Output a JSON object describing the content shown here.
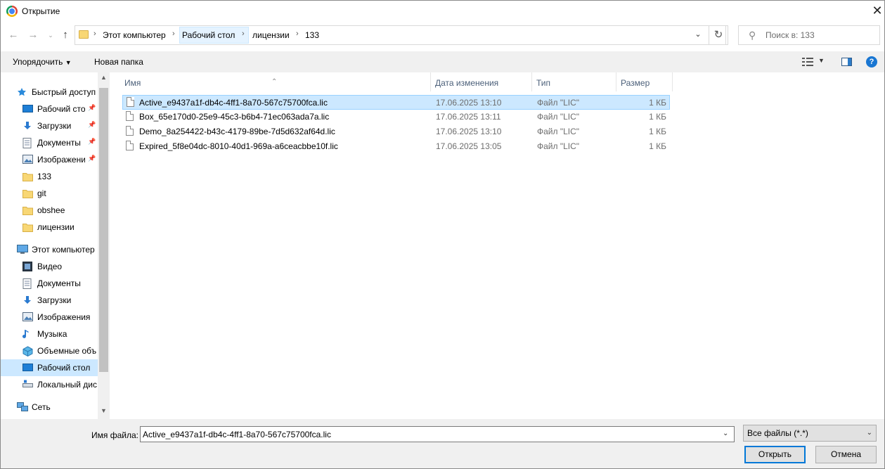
{
  "window": {
    "title": "Открытие"
  },
  "address": {
    "crumbs": [
      "Этот компьютер",
      "Рабочий стол",
      "лицензии",
      "133"
    ],
    "search_placeholder": "Поиск в: 133"
  },
  "toolbar": {
    "organize": "Упорядочить",
    "new_folder": "Новая папка"
  },
  "nav": {
    "items": [
      {
        "label": "Быстрый доступ",
        "icon": "star-icon"
      },
      {
        "label": "Рабочий сто.",
        "icon": "desktop-icon"
      },
      {
        "label": "Загрузки",
        "icon": "download-icon"
      },
      {
        "label": "Документы",
        "icon": "document-icon"
      },
      {
        "label": "Изображени",
        "icon": "pictures-icon"
      },
      {
        "label": "133",
        "icon": "folder-icon"
      },
      {
        "label": "git",
        "icon": "folder-icon"
      },
      {
        "label": "obshee",
        "icon": "folder-icon"
      },
      {
        "label": "лицензии",
        "icon": "folder-icon"
      },
      {
        "label": "Этот компьютер",
        "icon": "computer-icon"
      },
      {
        "label": "Видео",
        "icon": "video-icon"
      },
      {
        "label": "Документы",
        "icon": "document-icon"
      },
      {
        "label": "Загрузки",
        "icon": "download-icon"
      },
      {
        "label": "Изображения",
        "icon": "pictures-icon"
      },
      {
        "label": "Музыка",
        "icon": "music-icon"
      },
      {
        "label": "Объемные объ",
        "icon": "3d-objects-icon"
      },
      {
        "label": "Рабочий стол",
        "icon": "desktop-icon"
      },
      {
        "label": "Локальный дис",
        "icon": "drive-icon"
      },
      {
        "label": "Сеть",
        "icon": "network-icon"
      }
    ]
  },
  "columns": {
    "name": "Имя",
    "date": "Дата изменения",
    "type": "Тип",
    "size": "Размер"
  },
  "files": [
    {
      "name": "Active_e9437a1f-db4c-4ff1-8a70-567c75700fca.lic",
      "date": "17.06.2025 13:10",
      "type": "Файл \"LIC\"",
      "size": "1 КБ"
    },
    {
      "name": "Box_65e170d0-25e9-45c3-b6b4-71ec063ada7a.lic",
      "date": "17.06.2025 13:11",
      "type": "Файл \"LIC\"",
      "size": "1 КБ"
    },
    {
      "name": "Demo_8a254422-b43c-4179-89be-7d5d632af64d.lic",
      "date": "17.06.2025 13:10",
      "type": "Файл \"LIC\"",
      "size": "1 КБ"
    },
    {
      "name": "Expired_5f8e04dc-8010-40d1-969a-a6ceacbbe10f.lic",
      "date": "17.06.2025 13:05",
      "type": "Файл \"LIC\"",
      "size": "1 КБ"
    }
  ],
  "bottom": {
    "filename_label": "Имя файла:",
    "filename_value": "Active_e9437a1f-db4c-4ff1-8a70-567c75700fca.lic",
    "filetype_value": "Все файлы (*.*)",
    "open_label": "Открыть",
    "cancel_label": "Отмена"
  },
  "colors": {
    "selection": "#cce8ff",
    "selection_border": "#99d1ff",
    "accent": "#0078d7",
    "folder": "#f8d775"
  }
}
